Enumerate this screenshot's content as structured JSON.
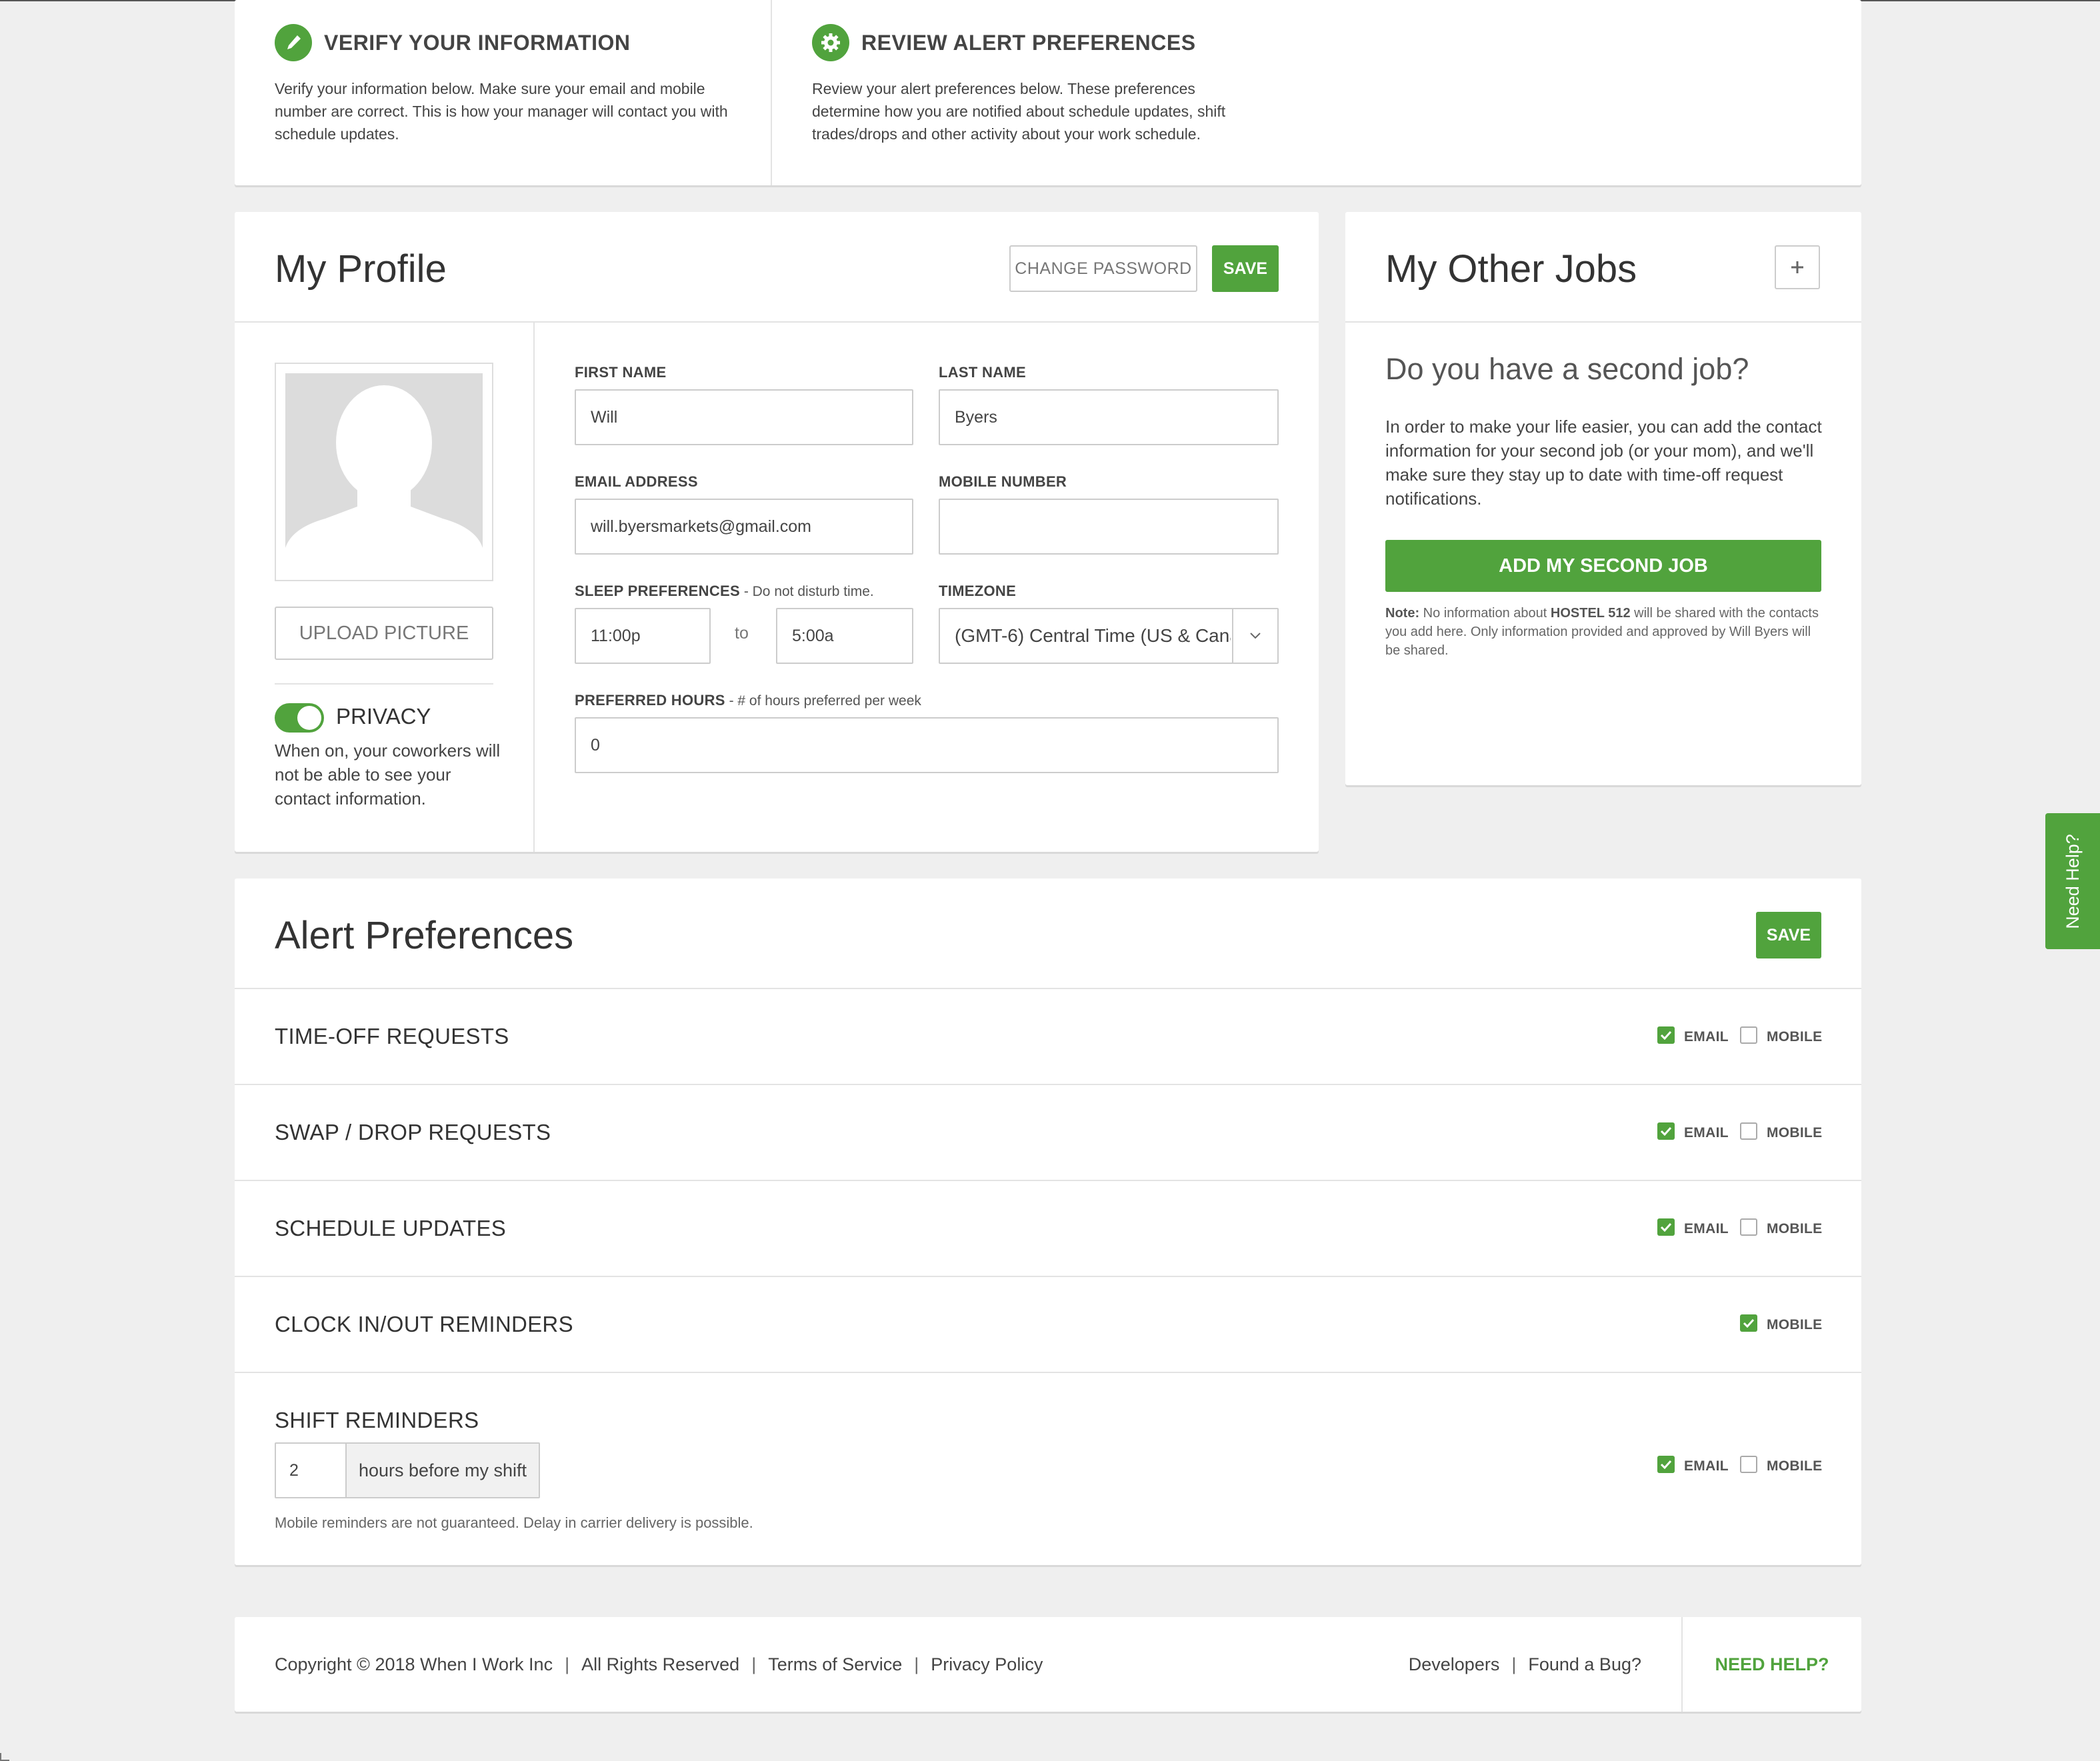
{
  "intro": {
    "verify_title": "VERIFY YOUR INFORMATION",
    "verify_text": "Verify your information below. Make sure your email and mobile number are correct. This is how your manager will contact you with schedule updates.",
    "verify_icon": "pencil-icon",
    "alerts_title": "REVIEW ALERT PREFERENCES",
    "alerts_text": "Review your alert preferences below. These preferences determine how you are notified about schedule updates, shift trades/drops and other activity about your work schedule.",
    "alerts_icon": "gear-icon"
  },
  "profile": {
    "title": "My Profile",
    "change_password_label": "CHANGE PASSWORD",
    "save_label": "SAVE",
    "upload_label": "UPLOAD PICTURE",
    "privacy_label": "PRIVACY",
    "privacy_on": true,
    "privacy_text": "When on, your coworkers will not be able to see your contact information.",
    "first_name_label": "FIRST NAME",
    "first_name": "Will",
    "last_name_label": "LAST NAME",
    "last_name": "Byers",
    "email_label": "EMAIL ADDRESS",
    "email": "will.byersmarkets@gmail.com",
    "mobile_label": "MOBILE NUMBER",
    "mobile": "",
    "sleep_label": "SLEEP PREFERENCES",
    "sleep_hint": " - Do not disturb time.",
    "sleep_from": "11:00p",
    "sleep_to_label": "to",
    "sleep_to": "5:00a",
    "timezone_label": "TIMEZONE",
    "timezone": "(GMT-6) Central Time (US & Canada)",
    "hours_label": "PREFERRED HOURS",
    "hours_hint": " - # of hours preferred per week",
    "hours": "0"
  },
  "jobs": {
    "title": "My Other Jobs",
    "add_icon": "plus-icon",
    "question": "Do you have a second job?",
    "text": "In order to make your life easier, you can add the contact information for your second job (or your mom), and we'll make sure they stay up to date with time-off request notifications.",
    "button_label": "ADD MY SECOND JOB",
    "note_prefix": "Note:",
    "note_mid1": " No information about ",
    "note_company": "HOSTEL 512",
    "note_mid2": " will be shared with the contacts you add here. Only information provided and approved by Will Byers will be shared."
  },
  "alerts": {
    "title": "Alert Preferences",
    "save_label": "SAVE",
    "email_label": "EMAIL",
    "mobile_label": "MOBILE",
    "rows": [
      {
        "label": "TIME-OFF REQUESTS",
        "email": true,
        "mobile": false
      },
      {
        "label": "SWAP / DROP REQUESTS",
        "email": true,
        "mobile": false
      },
      {
        "label": "SCHEDULE UPDATES",
        "email": true,
        "mobile": false
      },
      {
        "label": "CLOCK IN/OUT REMINDERS",
        "mobile": true
      },
      {
        "label": "SHIFT REMINDERS",
        "email": true,
        "mobile": false
      }
    ],
    "shift_hours": "2",
    "shift_hours_addon": "hours before my shift",
    "mobile_note": "Mobile reminders are not guaranteed. Delay in carrier delivery is possible."
  },
  "footer": {
    "copyright": "Copyright © 2018 When I Work Inc",
    "rights": "All Rights Reserved",
    "terms": "Terms of Service",
    "privacy": "Privacy Policy",
    "developers": "Developers",
    "bug": "Found a Bug?",
    "help": "NEED HELP?",
    "separator": "|"
  },
  "side_help": "Need Help?",
  "colors": {
    "accent": "#51a33d",
    "background": "#efefef",
    "border": "#e3e3e3"
  }
}
